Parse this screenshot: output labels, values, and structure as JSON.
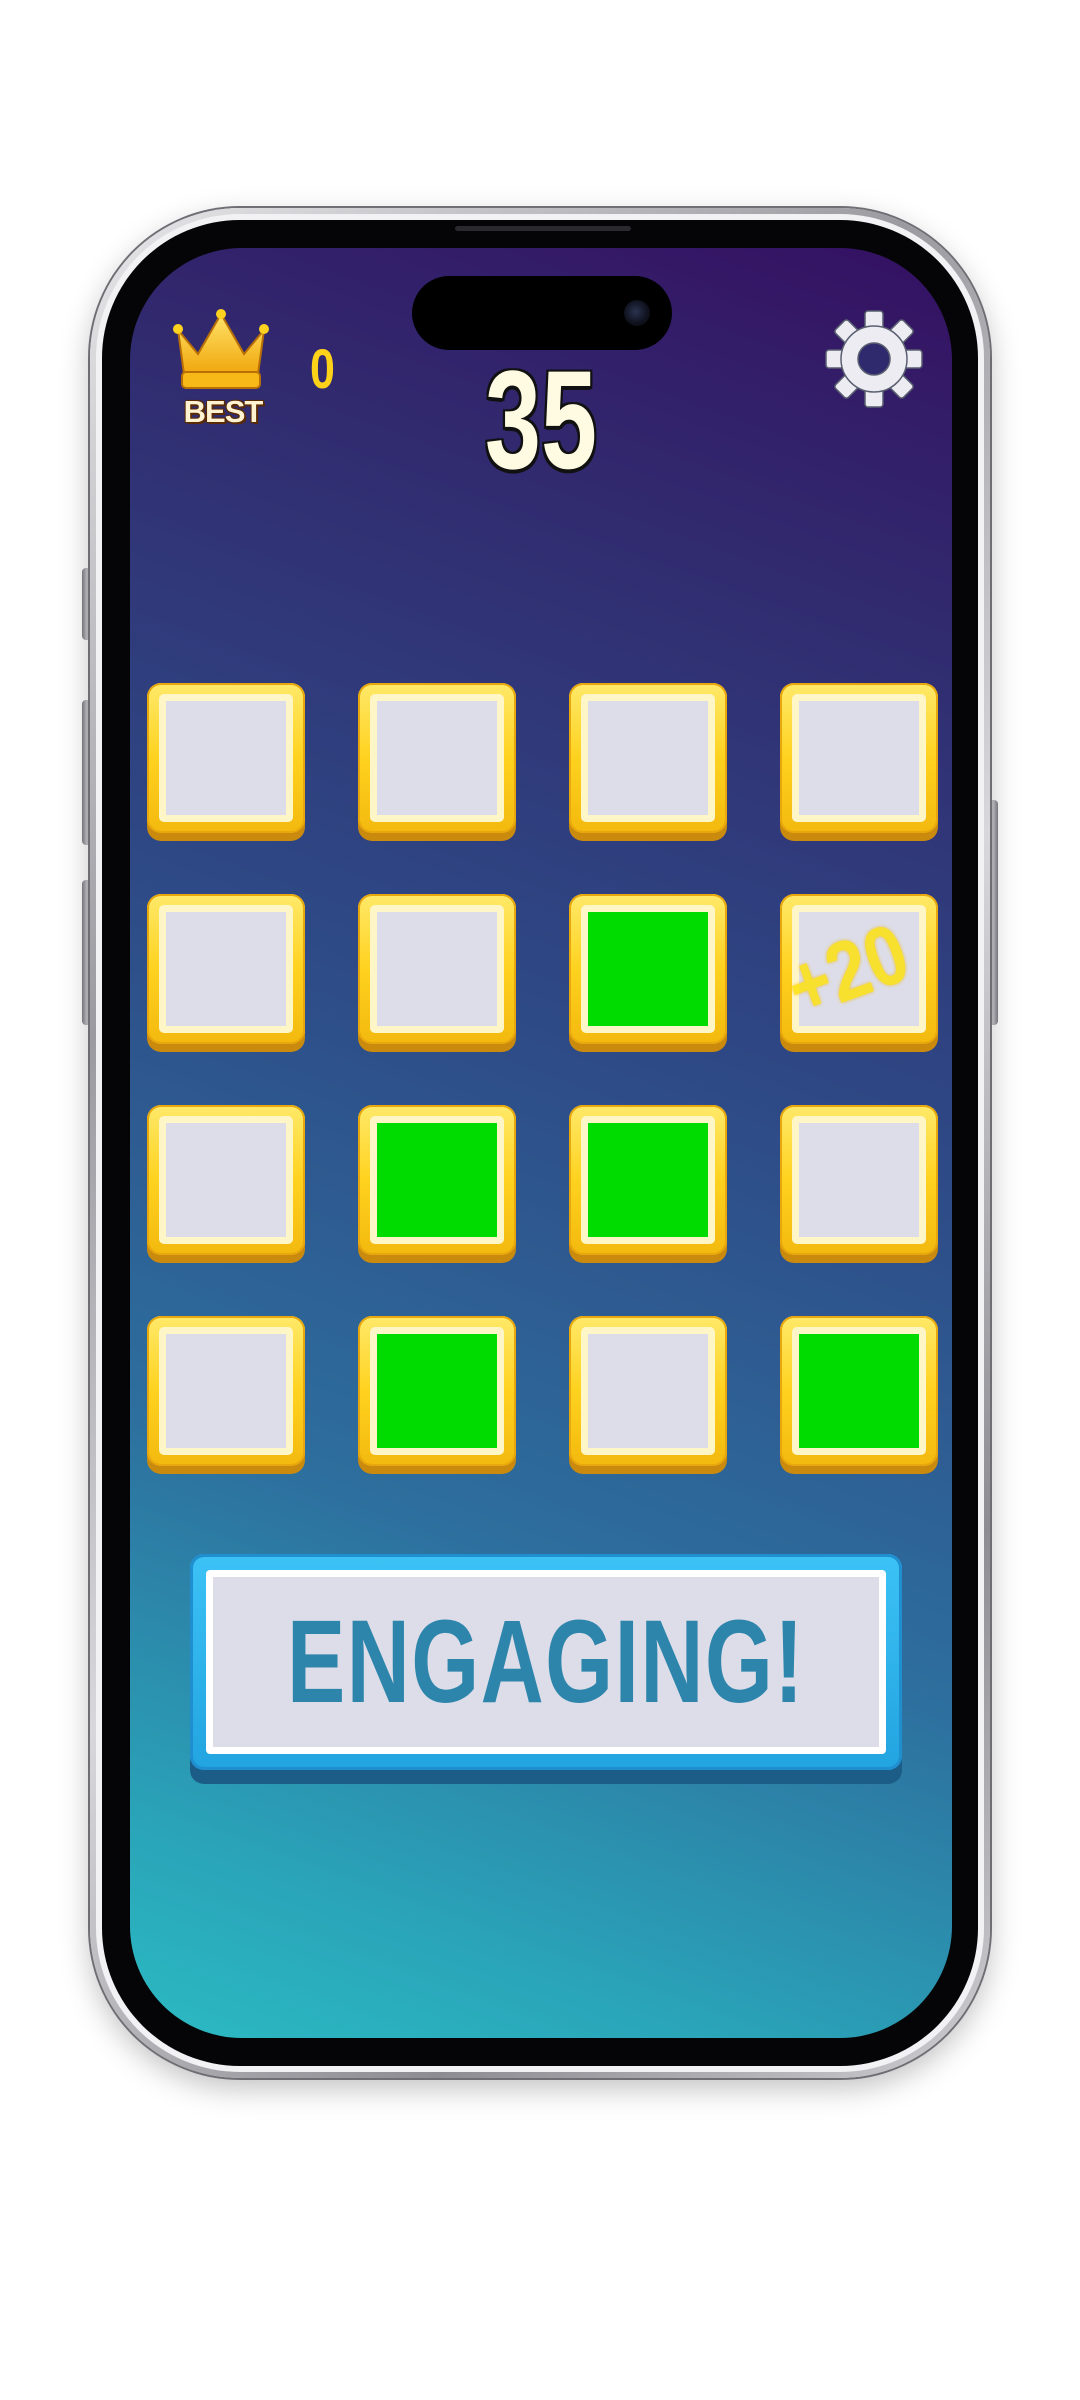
{
  "hud": {
    "best_label": "BEST",
    "best_value": "0",
    "score": "35",
    "settings_icon": "gear-icon",
    "best_icon": "crown-icon"
  },
  "grid": {
    "rows": 4,
    "cols": 4,
    "tiles": [
      [
        false,
        false,
        false,
        false
      ],
      [
        false,
        false,
        true,
        false
      ],
      [
        false,
        true,
        true,
        false
      ],
      [
        false,
        true,
        false,
        true
      ]
    ],
    "colors": {
      "active": "#00db00",
      "inactive": "#dcdde8",
      "frame": "#ffd21f"
    }
  },
  "popup": {
    "text": "+20"
  },
  "status_button": {
    "label": "ENGAGING!",
    "color": "#2e85ab"
  },
  "theme": {
    "background_top": "#351062",
    "background_bottom": "#2bbac3"
  }
}
